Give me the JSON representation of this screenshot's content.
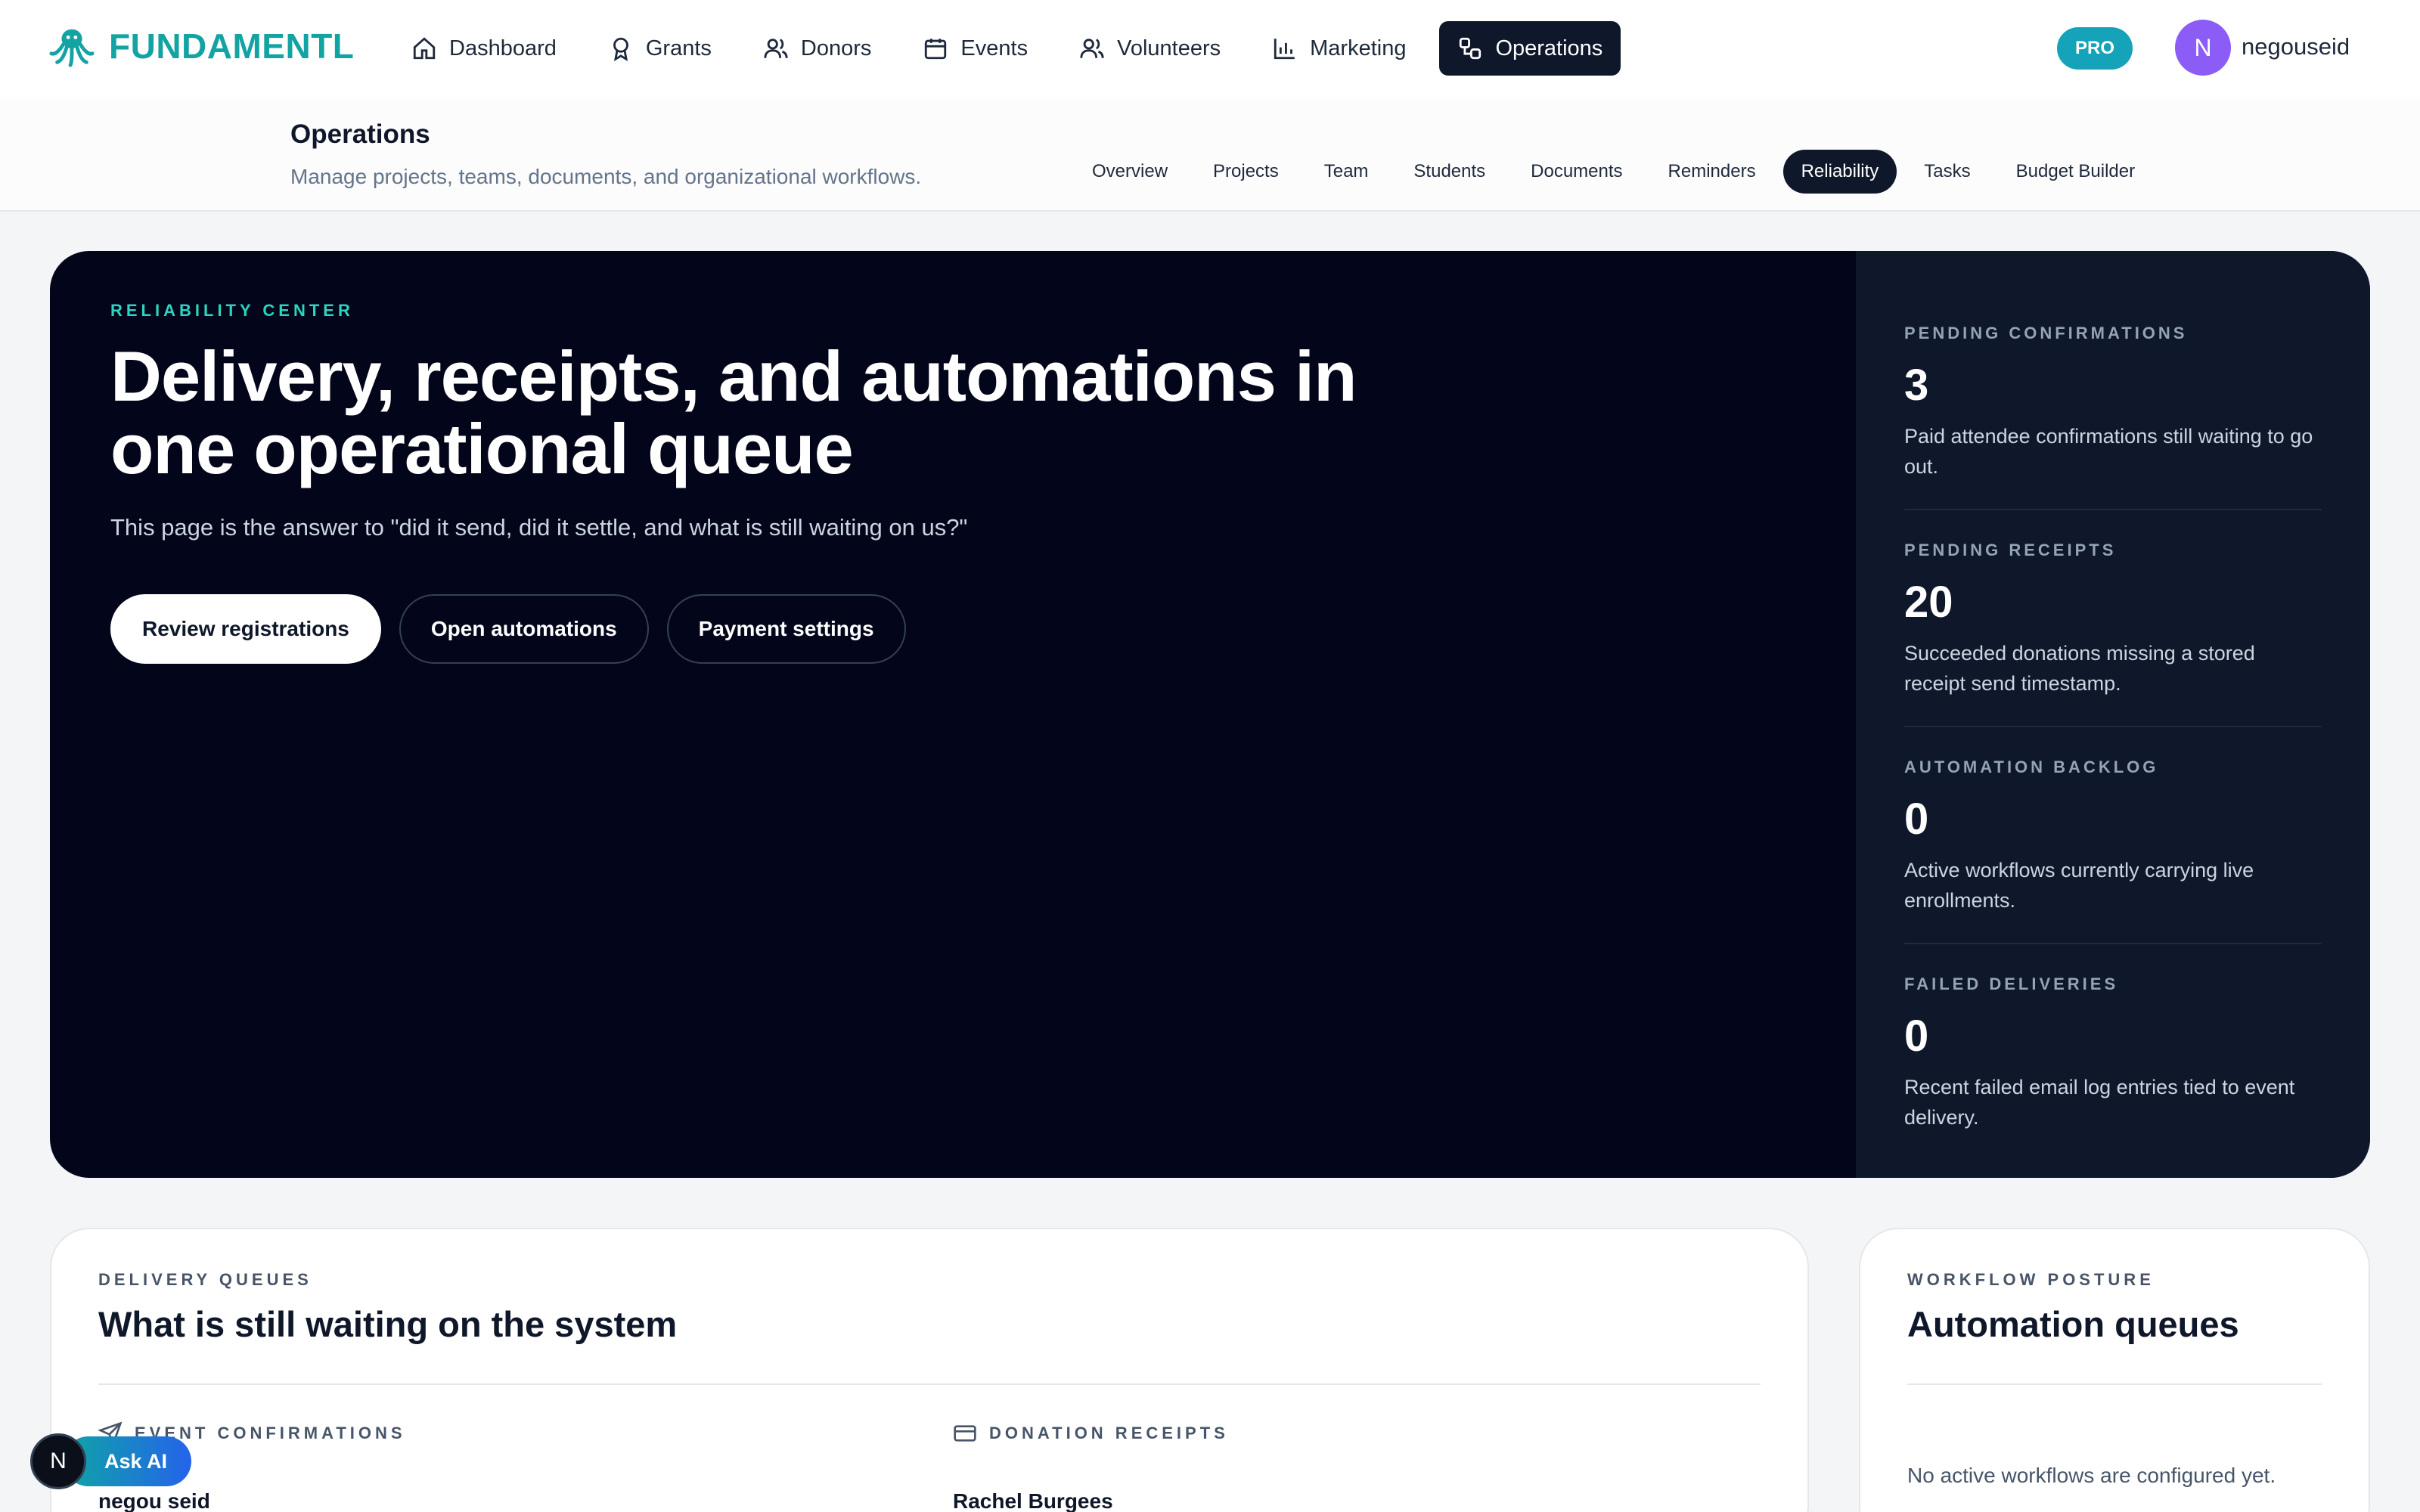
{
  "brand": {
    "name": "FUNDAMENTL",
    "logo_icon": "octopus-icon",
    "color": "#14a3a3"
  },
  "nav": {
    "items": [
      {
        "label": "Dashboard",
        "icon": "home-icon"
      },
      {
        "label": "Grants",
        "icon": "award-icon"
      },
      {
        "label": "Donors",
        "icon": "users-icon"
      },
      {
        "label": "Events",
        "icon": "calendar-icon"
      },
      {
        "label": "Volunteers",
        "icon": "people-icon"
      },
      {
        "label": "Marketing",
        "icon": "bar-chart-icon"
      },
      {
        "label": "Operations",
        "icon": "workflow-icon",
        "active": true
      }
    ]
  },
  "user": {
    "badge": "PRO",
    "initial": "N",
    "name": "negouseid"
  },
  "section": {
    "title": "Operations",
    "subtitle": "Manage projects, teams, documents, and organizational workflows.",
    "tabs": [
      "Overview",
      "Projects",
      "Team",
      "Students",
      "Documents",
      "Reminders",
      "Reliability",
      "Tasks",
      "Budget Builder"
    ],
    "active_tab": "Reliability"
  },
  "hero": {
    "eyebrow": "RELIABILITY CENTER",
    "title": "Delivery, receipts, and automations in one operational queue",
    "description": "This page is the answer to \"did it send, did it settle, and what is still waiting on us?\"",
    "buttons": {
      "review": "Review registrations",
      "automations": "Open automations",
      "payment": "Payment settings"
    },
    "metrics": [
      {
        "label": "PENDING CONFIRMATIONS",
        "value": "3",
        "description": "Paid attendee confirmations still waiting to go out."
      },
      {
        "label": "PENDING RECEIPTS",
        "value": "20",
        "description": "Succeeded donations missing a stored receipt send timestamp."
      },
      {
        "label": "AUTOMATION BACKLOG",
        "value": "0",
        "description": "Active workflows currently carrying live enrollments."
      },
      {
        "label": "FAILED DELIVERIES",
        "value": "0",
        "description": "Recent failed email log entries tied to event delivery."
      }
    ]
  },
  "delivery_card": {
    "eyebrow": "DELIVERY QUEUES",
    "title": "What is still waiting on the system",
    "columns": [
      {
        "heading": "EVENT CONFIRMATIONS",
        "icon": "send-icon",
        "first_entry": "negou seid"
      },
      {
        "heading": "DONATION RECEIPTS",
        "icon": "credit-card-icon",
        "first_entry": "Rachel Burgees"
      }
    ]
  },
  "workflow_card": {
    "eyebrow": "WORKFLOW POSTURE",
    "title": "Automation queues",
    "empty_message": "No active workflows are configured yet."
  },
  "ask_ai": {
    "initial": "N",
    "label": "Ask AI"
  },
  "colors": {
    "hero_bg": "#03061a",
    "hero_panel": "#0f172a",
    "accent_teal": "#2dd4bf",
    "pro_badge": "#14a3b8",
    "avatar": "#8b5cf6"
  }
}
